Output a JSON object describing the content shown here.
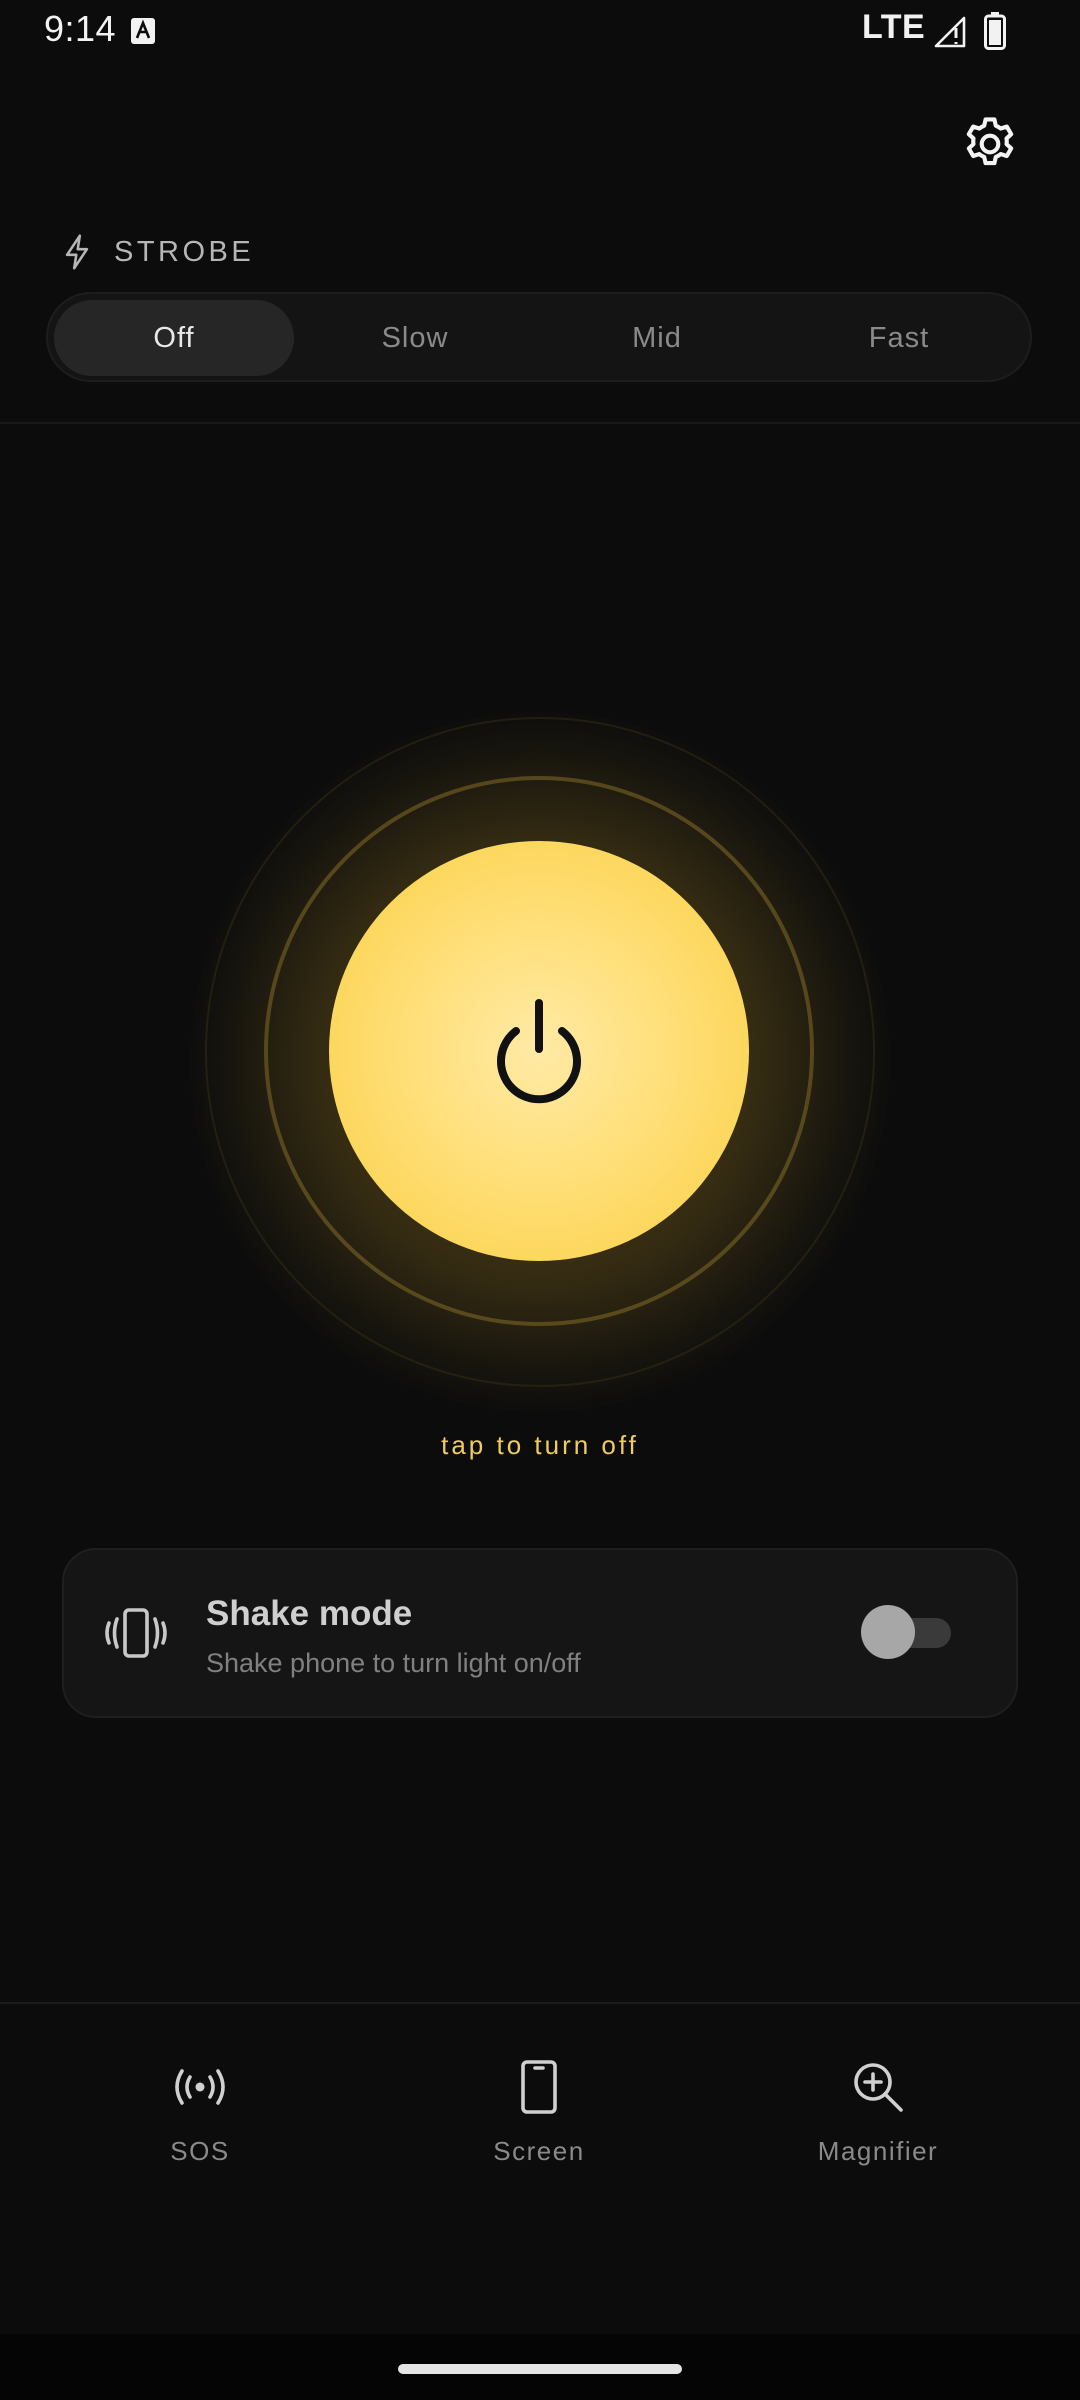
{
  "status_bar": {
    "time": "9:14",
    "network": "LTE",
    "icons": [
      "text-a-icon",
      "signal-icon",
      "battery-icon"
    ]
  },
  "header": {
    "settings_icon": "gear-icon"
  },
  "strobe": {
    "label": "STROBE",
    "icon": "lightning-icon",
    "options": [
      "Off",
      "Slow",
      "Mid",
      "Fast"
    ],
    "selected": "Off"
  },
  "power": {
    "icon": "power-icon",
    "state": "on",
    "hint": "tap to turn off",
    "color": "#fcd65a"
  },
  "shake_mode": {
    "title": "Shake mode",
    "subtitle": "Shake phone to turn light on/off",
    "icon": "vibrate-phone-icon",
    "enabled": false
  },
  "bottom_nav": {
    "items": [
      {
        "label": "SOS",
        "icon": "sos-broadcast-icon"
      },
      {
        "label": "Screen",
        "icon": "phone-screen-icon"
      },
      {
        "label": "Magnifier",
        "icon": "magnifier-zoom-icon"
      }
    ]
  },
  "colors": {
    "background": "#0c0c0c",
    "accent": "#f0cc60",
    "card": "#151515"
  }
}
